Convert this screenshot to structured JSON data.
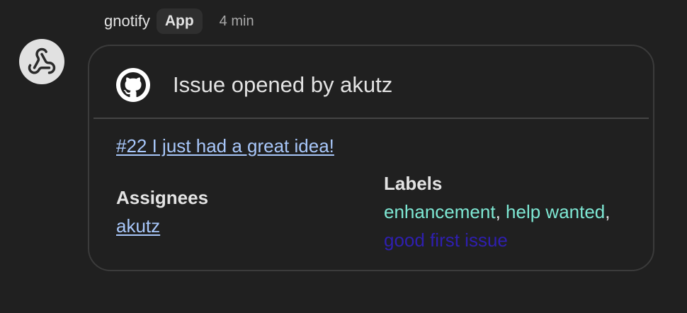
{
  "notification": {
    "sender": "gnotify",
    "badge": "App",
    "time": "4 min",
    "avatar_icon": "webhook-icon"
  },
  "card": {
    "header_icon": "github-icon",
    "title": "Issue opened by akutz",
    "issue_link": "#22 I just had a great idea!",
    "assignees": {
      "heading": "Assignees",
      "items": [
        "akutz"
      ]
    },
    "labels": {
      "heading": "Labels",
      "items": [
        {
          "text": "enhancement",
          "color": "#7ee8d4"
        },
        {
          "text": "help wanted",
          "color": "#7ee8d4"
        },
        {
          "text": "good first issue",
          "color": "#2f1fb0"
        }
      ],
      "separator": ","
    }
  },
  "colors": {
    "background": "#202020",
    "link": "#a8c7fa",
    "card_border": "#3b3b3b"
  }
}
